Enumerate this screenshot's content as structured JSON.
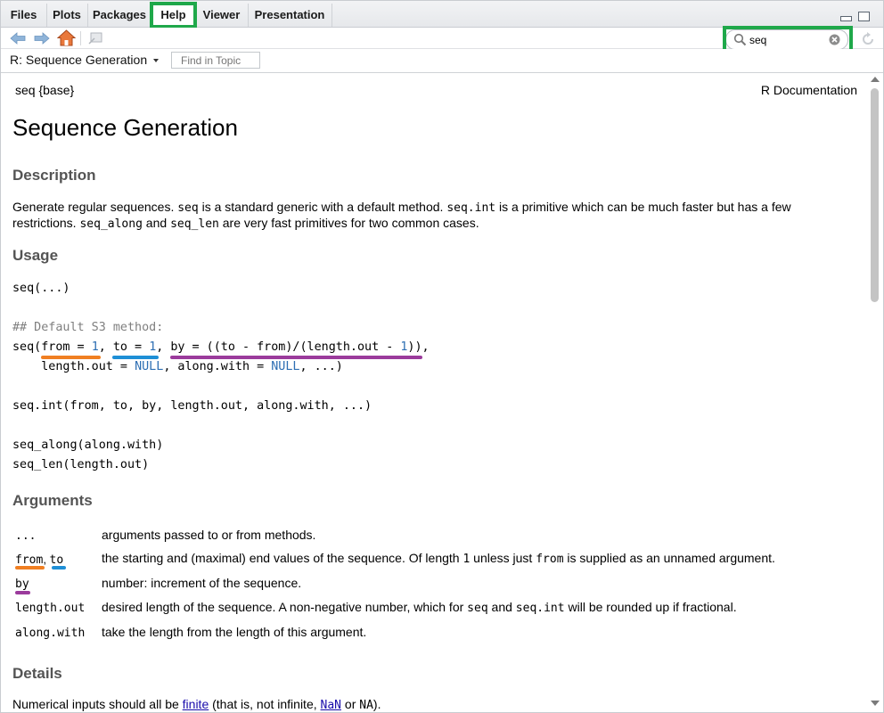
{
  "tabs": [
    {
      "label": "Files"
    },
    {
      "label": "Plots"
    },
    {
      "label": "Packages"
    },
    {
      "label": "Help"
    },
    {
      "label": "Viewer"
    },
    {
      "label": "Presentation"
    }
  ],
  "search": {
    "value": "seq"
  },
  "topic_bar": {
    "title": "R: Sequence Generation",
    "find_placeholder": "Find in Topic"
  },
  "doc": {
    "package_label": "seq {base}",
    "documentation_label": "R Documentation",
    "title": "Sequence Generation",
    "description_heading": "Description",
    "description": {
      "s1": "Generate regular sequences. ",
      "c1": "seq",
      "s2": " is a standard generic with a default method. ",
      "c2": "seq.int",
      "s3": " is a primitive which can be much faster but has a few restrictions. ",
      "c3": "seq_along",
      "s4": " and ",
      "c4": "seq_len",
      "s5": " are very fast primitives for two common cases."
    },
    "usage_heading": "Usage",
    "usage": {
      "line1": "seq(...)",
      "comment": "## Default S3 method:",
      "default_line1_a": "seq(from = ",
      "default_line1_num1": "1",
      "default_line1_b": ", to = ",
      "default_line1_num2": "1",
      "default_line1_c": ", by = ((to - from)/(length.out - ",
      "default_line1_num3": "1",
      "default_line1_d": ")),",
      "default_line2_a": "    length.out = ",
      "default_line2_null1": "NULL",
      "default_line2_b": ", along.with = ",
      "default_line2_null2": "NULL",
      "default_line2_c": ", ...)",
      "seq_int": "seq.int(from, to, by, length.out, along.with, ...)",
      "seq_along": "seq_along(along.with)",
      "seq_len": "seq_len(length.out)"
    },
    "arguments_heading": "Arguments",
    "arguments": [
      {
        "name": "...",
        "desc": "arguments passed to or from methods."
      },
      {
        "name_a": "from",
        "name_b": "to",
        "desc_a": "the starting and (maximal) end values of the sequence. Of length ",
        "desc_code1": "1",
        "desc_b": " unless just ",
        "desc_code2": "from",
        "desc_c": " is supplied as an unnamed argument."
      },
      {
        "name": "by",
        "desc": "number: increment of the sequence."
      },
      {
        "name": "length.out",
        "desc_a": "desired length of the sequence. A non-negative number, which for ",
        "desc_code1": "seq",
        "desc_b": " and ",
        "desc_code2": "seq.int",
        "desc_c": " will be rounded up if fractional."
      },
      {
        "name": "along.with",
        "desc": "take the length from the length of this argument."
      }
    ],
    "details_heading": "Details",
    "details": {
      "s1": "Numerical inputs should all be ",
      "link1": "finite",
      "s2": " (that is, not infinite, ",
      "link2": "NaN",
      "s3": " or ",
      "c1": "NA",
      "s4": ")."
    }
  },
  "colors": {
    "highlight_green": "#1fa84a",
    "underline_orange": "#f07f22",
    "underline_blue": "#1e8fd6",
    "underline_purple": "#9b3b9c"
  },
  "icons": [
    "back-arrow-icon",
    "forward-arrow-icon",
    "home-icon",
    "show-in-window-icon",
    "search-icon",
    "clear-search-icon",
    "refresh-icon",
    "minimize-icon",
    "maximize-icon",
    "chevron-down-icon"
  ]
}
